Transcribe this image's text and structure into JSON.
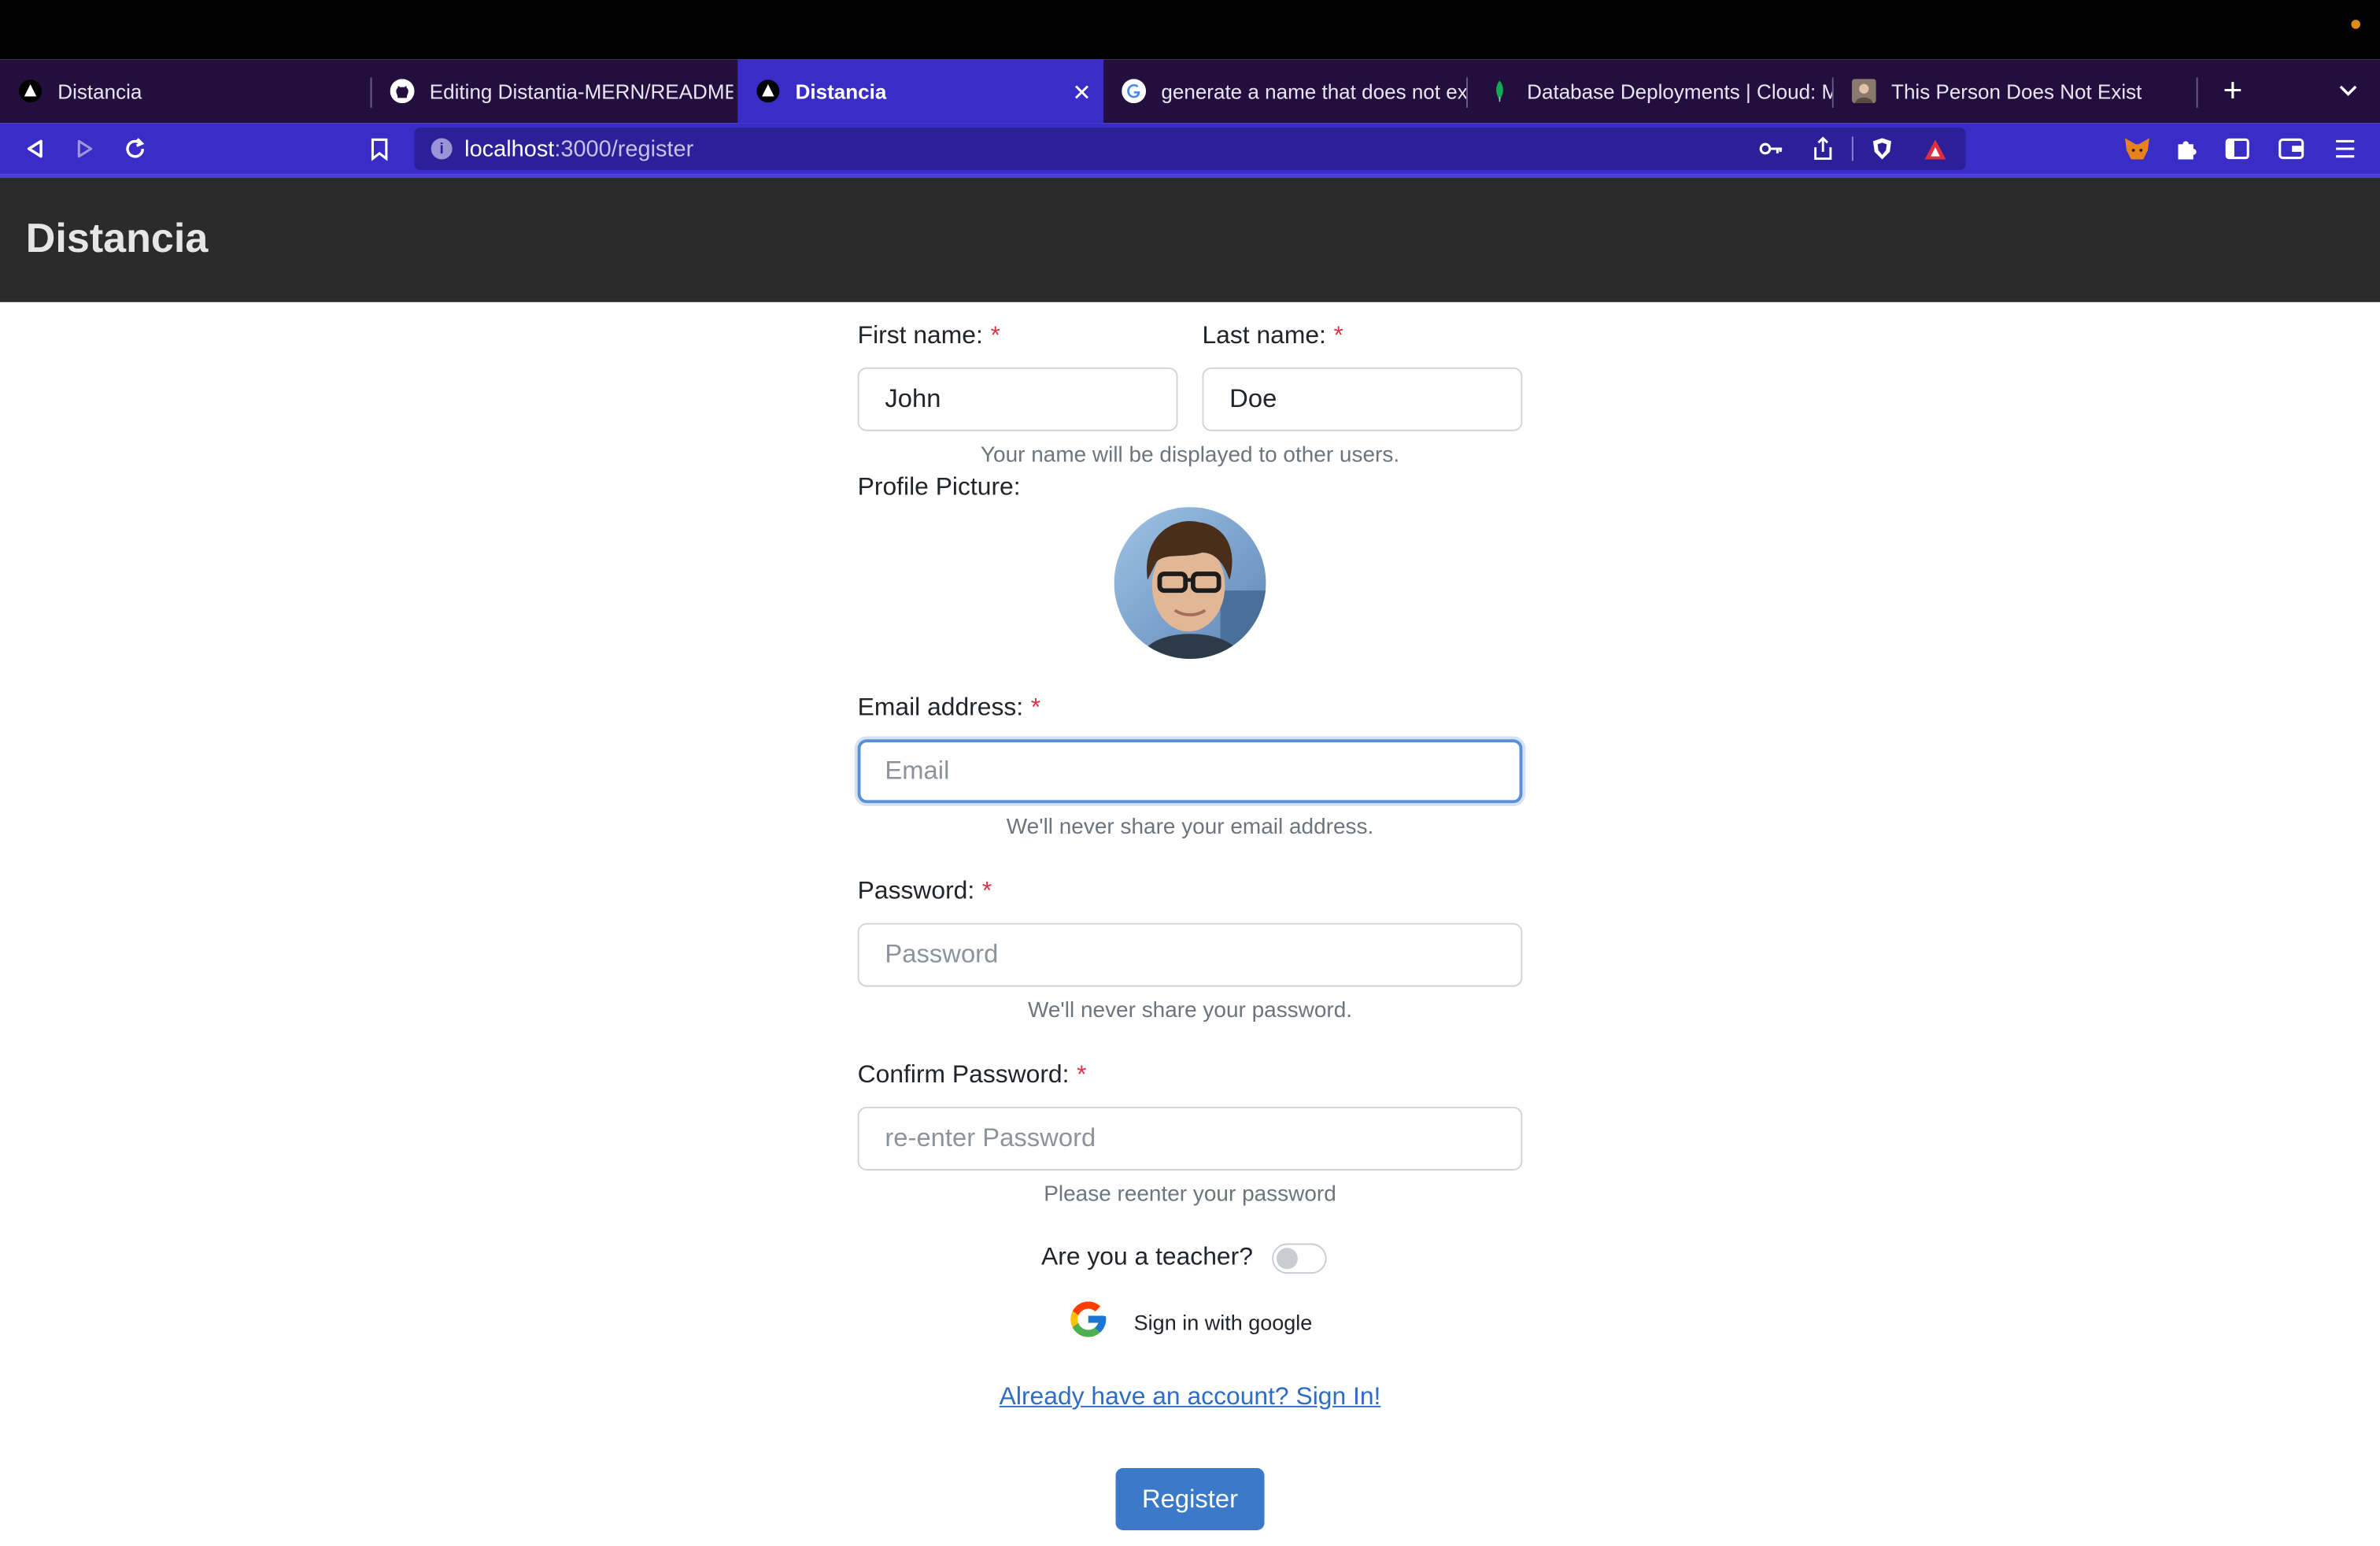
{
  "browser": {
    "tabs": [
      {
        "title": "Distancia",
        "icon": "triangle-logo-icon"
      },
      {
        "title": "Editing Distantia-MERN/README.md",
        "icon": "github-icon"
      },
      {
        "title": "Distancia",
        "icon": "triangle-logo-icon",
        "active": true
      },
      {
        "title": "generate a name that does not exist",
        "icon": "google-icon"
      },
      {
        "title": "Database Deployments | Cloud: MongoDB",
        "icon": "mongodb-leaf-icon"
      },
      {
        "title": "This Person Does Not Exist",
        "icon": "person-photo-icon"
      }
    ],
    "url_host": "localhost",
    "url_path": ":3000/register"
  },
  "app": {
    "brand": "Distancia"
  },
  "form": {
    "first_name_label": "First name:",
    "last_name_label": "Last name:",
    "first_name_value": "John",
    "last_name_value": "Doe",
    "name_help": "Your name will be displayed to other users.",
    "profile_picture_label": "Profile Picture:",
    "email_label": "Email address:",
    "email_placeholder": "Email",
    "email_help": "We'll never share your email address.",
    "password_label": "Password:",
    "password_placeholder": "Password",
    "password_help": "We'll never share your password.",
    "confirm_label": "Confirm Password:",
    "confirm_placeholder": "re-enter Password",
    "confirm_help": "Please reenter your password",
    "teacher_label": "Are you a teacher?",
    "teacher_toggle_on": false,
    "google_signin": "Sign in with google",
    "signin_link": "Already have an account? Sign In!",
    "register_button": "Register",
    "required_mark": "*"
  },
  "colors": {
    "tab_bar": "#220f3e",
    "address_bar": "#3a2cc7",
    "app_header": "#2b2b2b",
    "required": "#dc3545",
    "primary": "#3b79c9"
  }
}
